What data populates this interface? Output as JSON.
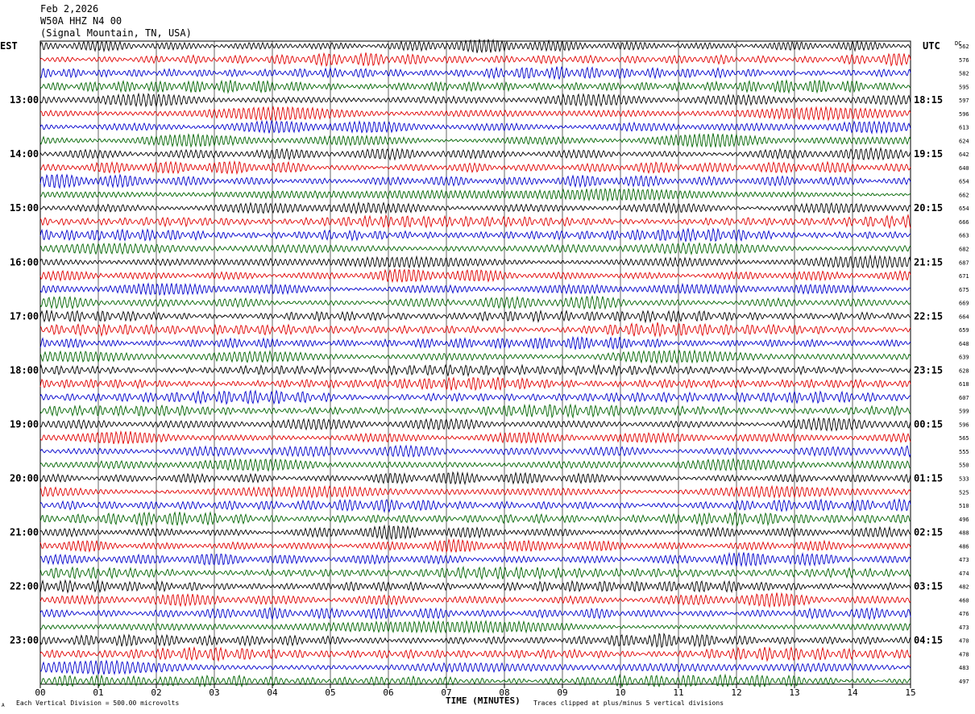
{
  "header": {
    "date": "Feb 2,2026",
    "station": "W50A HHZ N4 00",
    "location": "(Signal Mountain, TN, USA)"
  },
  "axes": {
    "left_tz": "EST",
    "right_tz": "UTC",
    "dc_label": "DC",
    "xlabel": "TIME (MINUTES)"
  },
  "footer": {
    "division": "Each Vertical Division =  500.00 microvolts",
    "clipping": "Traces clipped at plus/minus 5 vertical divisions",
    "corner_mark": "A"
  },
  "chart_data": {
    "type": "line",
    "xlim": [
      0,
      15
    ],
    "x_ticks": [
      "00",
      "01",
      "02",
      "03",
      "04",
      "05",
      "06",
      "07",
      "08",
      "09",
      "10",
      "11",
      "12",
      "13",
      "14",
      "15"
    ],
    "trace_colors": [
      "#000000",
      "#e00000",
      "#0000cc",
      "#006400"
    ],
    "left_hour_labels": [
      "13:00",
      "14:00",
      "15:00",
      "16:00",
      "17:00",
      "18:00",
      "19:00",
      "20:00",
      "21:00",
      "22:00",
      "23:00"
    ],
    "right_hour_labels": [
      "18:15",
      "19:15",
      "20:15",
      "21:15",
      "22:15",
      "23:15",
      "00:15",
      "01:15",
      "02:15",
      "03:15",
      "04:15"
    ],
    "dc_offsets": [
      562,
      576,
      582,
      595,
      597,
      596,
      613,
      624,
      642,
      640,
      654,
      662,
      654,
      666,
      663,
      682,
      687,
      671,
      675,
      669,
      664,
      659,
      648,
      639,
      628,
      618,
      607,
      599,
      596,
      565,
      555,
      550,
      533,
      525,
      510,
      496,
      488,
      486,
      473,
      474,
      482,
      460,
      476,
      473,
      470,
      478,
      483,
      497
    ]
  }
}
